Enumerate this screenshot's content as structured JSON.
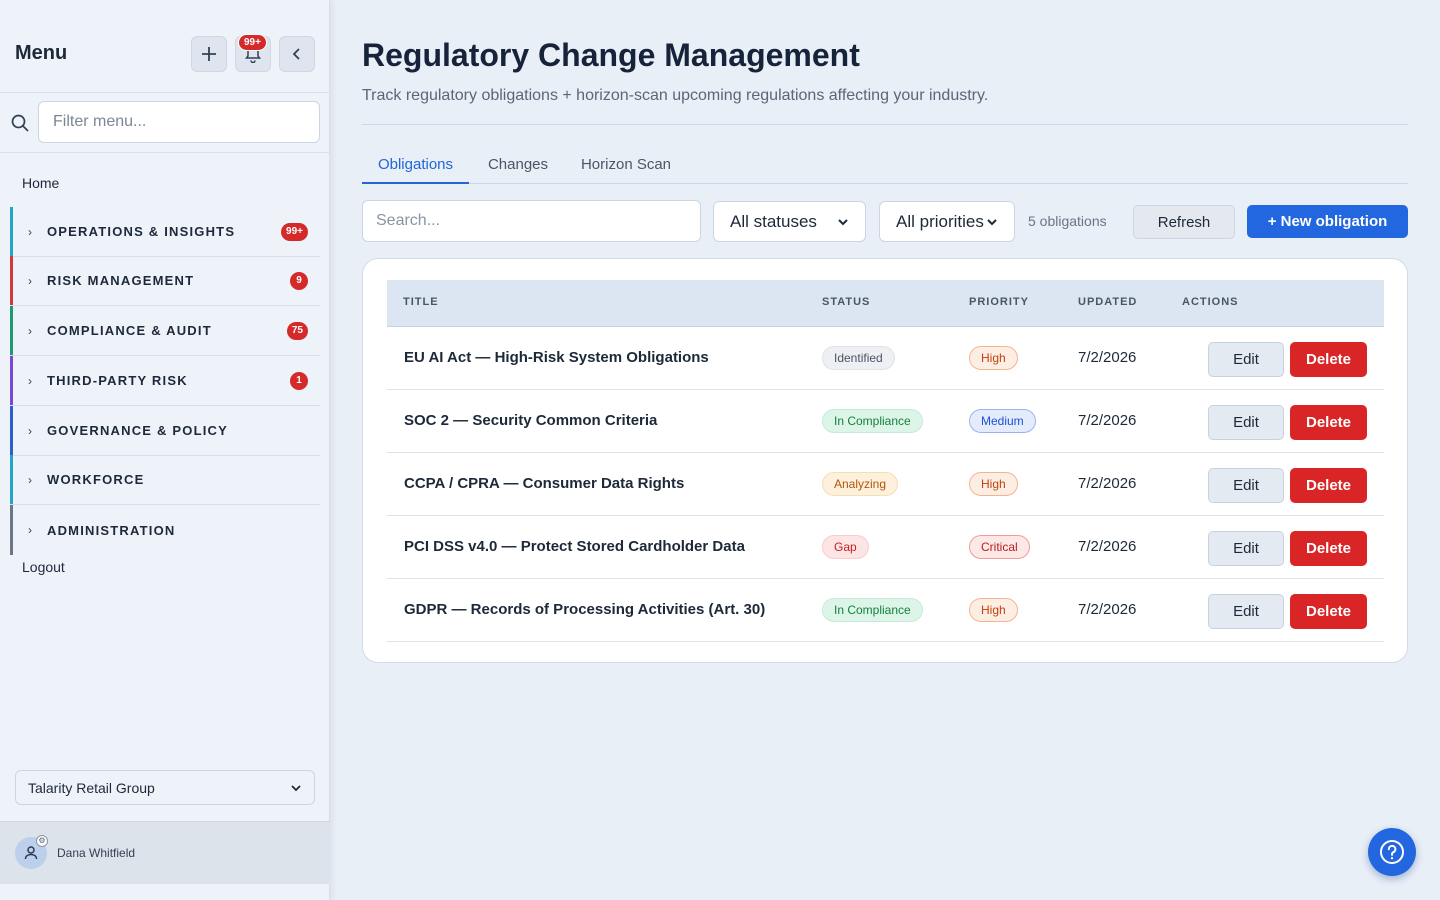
{
  "sidebar": {
    "title": "Menu",
    "notification_badge": "99+",
    "filter_placeholder": "Filter menu...",
    "home": "Home",
    "logout": "Logout",
    "sections": [
      {
        "label": "OPERATIONS & INSIGHTS",
        "badge": "99+",
        "color": "#23a3c5"
      },
      {
        "label": "RISK MANAGEMENT",
        "badge": "9",
        "color": "#d23a3a"
      },
      {
        "label": "COMPLIANCE & AUDIT",
        "badge": "75",
        "color": "#1e9b6e"
      },
      {
        "label": "THIRD-PARTY RISK",
        "badge": "1",
        "color": "#7a47d6"
      },
      {
        "label": "GOVERNANCE & POLICY",
        "badge": "",
        "color": "#2f5ccf"
      },
      {
        "label": "WORKFORCE",
        "badge": "",
        "color": "#23a3c5"
      },
      {
        "label": "ADMINISTRATION",
        "badge": "",
        "color": "#6b7686"
      }
    ],
    "org_selected": "Talarity Retail Group",
    "user_name": "Dana Whitfield"
  },
  "page": {
    "title": "Regulatory Change Management",
    "subtitle": "Track regulatory obligations + horizon-scan upcoming regulations affecting your industry."
  },
  "tabs": [
    "Obligations",
    "Changes",
    "Horizon Scan"
  ],
  "toolbar": {
    "search_placeholder": "Search...",
    "status_filter": "All statuses",
    "priority_filter": "All priorities",
    "count": "5 obligations",
    "refresh": "Refresh",
    "new": "+ New obligation"
  },
  "table": {
    "headers": {
      "title": "TITLE",
      "status": "STATUS",
      "priority": "PRIORITY",
      "updated": "UPDATED",
      "actions": "ACTIONS"
    },
    "edit_label": "Edit",
    "delete_label": "Delete",
    "rows": [
      {
        "title": "EU AI Act — High-Risk System Obligations",
        "status": "Identified",
        "priority": "High",
        "updated": "7/2/2026"
      },
      {
        "title": "SOC 2 — Security Common Criteria",
        "status": "In Compliance",
        "priority": "Medium",
        "updated": "7/2/2026"
      },
      {
        "title": "CCPA / CPRA — Consumer Data Rights",
        "status": "Analyzing",
        "priority": "High",
        "updated": "7/2/2026"
      },
      {
        "title": "PCI DSS v4.0 — Protect Stored Cardholder Data",
        "status": "Gap",
        "priority": "Critical",
        "updated": "7/2/2026"
      },
      {
        "title": "GDPR — Records of Processing Activities (Art. 30)",
        "status": "In Compliance",
        "priority": "High",
        "updated": "7/2/2026"
      }
    ]
  },
  "colors": {
    "accent": "#2266e0",
    "danger": "#d92525"
  }
}
